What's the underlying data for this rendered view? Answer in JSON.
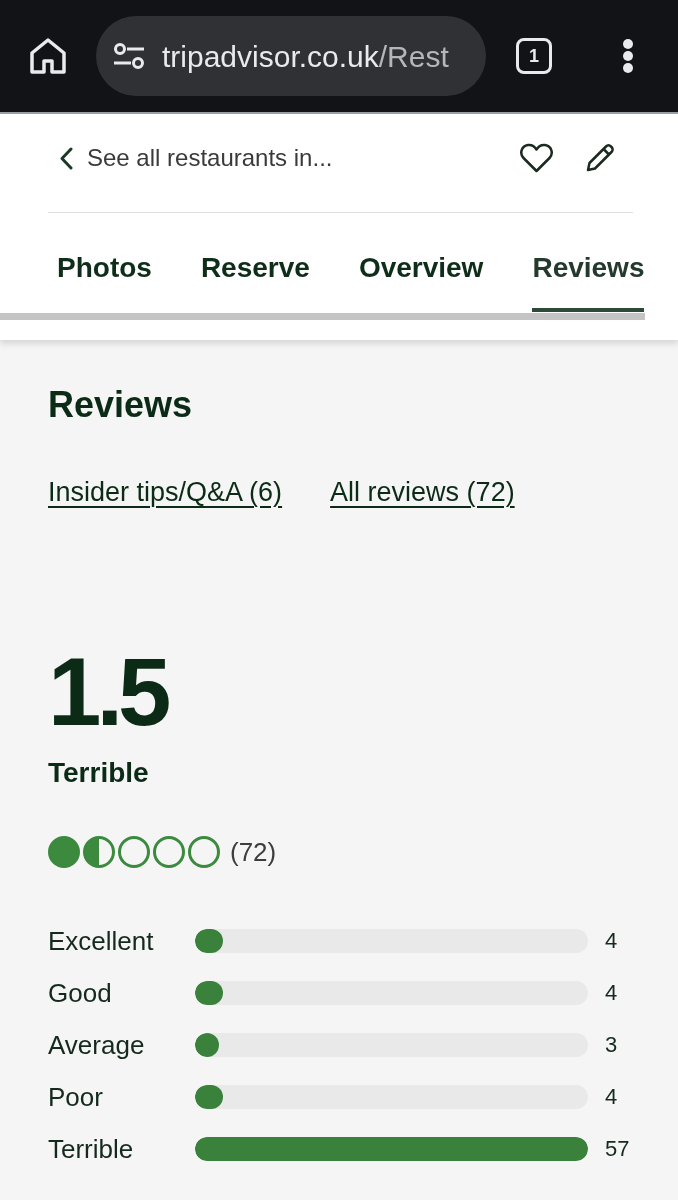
{
  "browser": {
    "url_host": "tripadvisor.co.uk",
    "url_path": "/Rest",
    "tab_count": "1"
  },
  "header": {
    "back_link": "See all restaurants in...",
    "tabs": [
      {
        "label": "Photos",
        "selected": false
      },
      {
        "label": "Reserve",
        "selected": false
      },
      {
        "label": "Overview",
        "selected": false
      },
      {
        "label": "Reviews",
        "selected": true
      }
    ]
  },
  "reviews": {
    "title": "Reviews",
    "links": [
      "Insider tips/Q&A (6)",
      "All reviews (72)"
    ],
    "rating": {
      "score": "1.5",
      "verdict": "Terrible",
      "stars": 1.5,
      "count": "(72)"
    },
    "distribution": [
      {
        "label": "Excellent",
        "level": 0.07,
        "count": "4"
      },
      {
        "label": "Good",
        "level": 0.07,
        "count": "4"
      },
      {
        "label": "Average",
        "level": 0.05,
        "count": "3"
      },
      {
        "label": "Poor",
        "level": 0.07,
        "count": "4"
      },
      {
        "label": "Terrible",
        "level": 1,
        "count": "57"
      }
    ]
  }
}
